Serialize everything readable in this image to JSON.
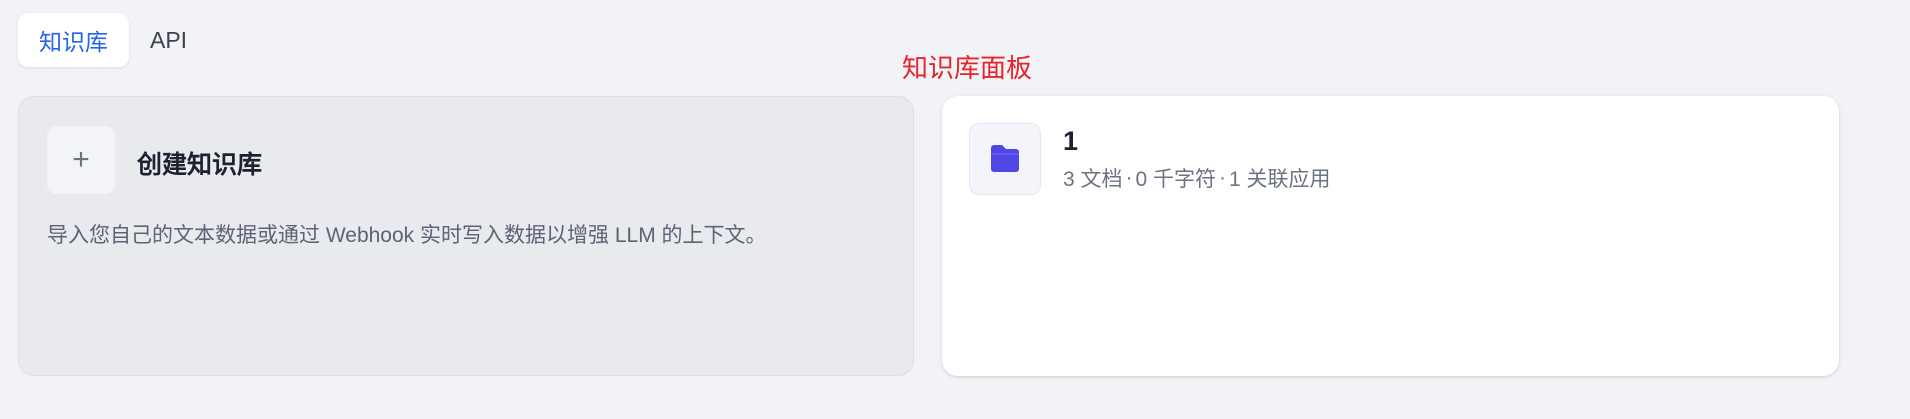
{
  "tabs": [
    {
      "label": "知识库",
      "active": true
    },
    {
      "label": "API",
      "active": false
    }
  ],
  "annotation": "知识库面板",
  "create_card": {
    "plus_icon": "+",
    "title": "创建知识库",
    "description": "导入您自己的文本数据或通过 Webhook 实时写入数据以增强 LLM 的上下文。"
  },
  "knowledge_base": {
    "icon": "folder-icon",
    "name": "1",
    "docs": "3 文档",
    "chars": "0 千字符",
    "apps": "1 关联应用",
    "separator": "·"
  },
  "colors": {
    "accent": "#2563eb",
    "folder": "#4f46e5",
    "annotation": "#e5242b"
  }
}
